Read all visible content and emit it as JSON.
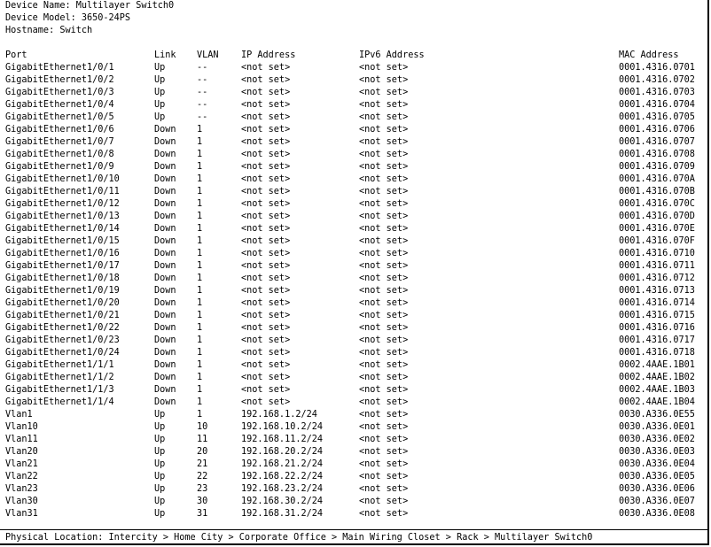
{
  "device": {
    "name_line": "Device Name: Multilayer Switch0",
    "model_line": "Device Model: 3650-24PS",
    "hostname_line": "Hostname: Switch"
  },
  "table": {
    "headers": {
      "port": "Port",
      "link": "Link",
      "vlan": "VLAN",
      "ip": "IP Address",
      "ipv6": "IPv6 Address",
      "mac": "MAC Address"
    },
    "rows": [
      {
        "port": "GigabitEthernet1/0/1",
        "link": "Up",
        "vlan": "--",
        "ip": "<not set>",
        "ipv6": "<not set>",
        "mac": "0001.4316.0701"
      },
      {
        "port": "GigabitEthernet1/0/2",
        "link": "Up",
        "vlan": "--",
        "ip": "<not set>",
        "ipv6": "<not set>",
        "mac": "0001.4316.0702"
      },
      {
        "port": "GigabitEthernet1/0/3",
        "link": "Up",
        "vlan": "--",
        "ip": "<not set>",
        "ipv6": "<not set>",
        "mac": "0001.4316.0703"
      },
      {
        "port": "GigabitEthernet1/0/4",
        "link": "Up",
        "vlan": "--",
        "ip": "<not set>",
        "ipv6": "<not set>",
        "mac": "0001.4316.0704"
      },
      {
        "port": "GigabitEthernet1/0/5",
        "link": "Up",
        "vlan": "--",
        "ip": "<not set>",
        "ipv6": "<not set>",
        "mac": "0001.4316.0705"
      },
      {
        "port": "GigabitEthernet1/0/6",
        "link": "Down",
        "vlan": "1",
        "ip": "<not set>",
        "ipv6": "<not set>",
        "mac": "0001.4316.0706"
      },
      {
        "port": "GigabitEthernet1/0/7",
        "link": "Down",
        "vlan": "1",
        "ip": "<not set>",
        "ipv6": "<not set>",
        "mac": "0001.4316.0707"
      },
      {
        "port": "GigabitEthernet1/0/8",
        "link": "Down",
        "vlan": "1",
        "ip": "<not set>",
        "ipv6": "<not set>",
        "mac": "0001.4316.0708"
      },
      {
        "port": "GigabitEthernet1/0/9",
        "link": "Down",
        "vlan": "1",
        "ip": "<not set>",
        "ipv6": "<not set>",
        "mac": "0001.4316.0709"
      },
      {
        "port": "GigabitEthernet1/0/10",
        "link": "Down",
        "vlan": "1",
        "ip": "<not set>",
        "ipv6": "<not set>",
        "mac": "0001.4316.070A"
      },
      {
        "port": "GigabitEthernet1/0/11",
        "link": "Down",
        "vlan": "1",
        "ip": "<not set>",
        "ipv6": "<not set>",
        "mac": "0001.4316.070B"
      },
      {
        "port": "GigabitEthernet1/0/12",
        "link": "Down",
        "vlan": "1",
        "ip": "<not set>",
        "ipv6": "<not set>",
        "mac": "0001.4316.070C"
      },
      {
        "port": "GigabitEthernet1/0/13",
        "link": "Down",
        "vlan": "1",
        "ip": "<not set>",
        "ipv6": "<not set>",
        "mac": "0001.4316.070D"
      },
      {
        "port": "GigabitEthernet1/0/14",
        "link": "Down",
        "vlan": "1",
        "ip": "<not set>",
        "ipv6": "<not set>",
        "mac": "0001.4316.070E"
      },
      {
        "port": "GigabitEthernet1/0/15",
        "link": "Down",
        "vlan": "1",
        "ip": "<not set>",
        "ipv6": "<not set>",
        "mac": "0001.4316.070F"
      },
      {
        "port": "GigabitEthernet1/0/16",
        "link": "Down",
        "vlan": "1",
        "ip": "<not set>",
        "ipv6": "<not set>",
        "mac": "0001.4316.0710"
      },
      {
        "port": "GigabitEthernet1/0/17",
        "link": "Down",
        "vlan": "1",
        "ip": "<not set>",
        "ipv6": "<not set>",
        "mac": "0001.4316.0711"
      },
      {
        "port": "GigabitEthernet1/0/18",
        "link": "Down",
        "vlan": "1",
        "ip": "<not set>",
        "ipv6": "<not set>",
        "mac": "0001.4316.0712"
      },
      {
        "port": "GigabitEthernet1/0/19",
        "link": "Down",
        "vlan": "1",
        "ip": "<not set>",
        "ipv6": "<not set>",
        "mac": "0001.4316.0713"
      },
      {
        "port": "GigabitEthernet1/0/20",
        "link": "Down",
        "vlan": "1",
        "ip": "<not set>",
        "ipv6": "<not set>",
        "mac": "0001.4316.0714"
      },
      {
        "port": "GigabitEthernet1/0/21",
        "link": "Down",
        "vlan": "1",
        "ip": "<not set>",
        "ipv6": "<not set>",
        "mac": "0001.4316.0715"
      },
      {
        "port": "GigabitEthernet1/0/22",
        "link": "Down",
        "vlan": "1",
        "ip": "<not set>",
        "ipv6": "<not set>",
        "mac": "0001.4316.0716"
      },
      {
        "port": "GigabitEthernet1/0/23",
        "link": "Down",
        "vlan": "1",
        "ip": "<not set>",
        "ipv6": "<not set>",
        "mac": "0001.4316.0717"
      },
      {
        "port": "GigabitEthernet1/0/24",
        "link": "Down",
        "vlan": "1",
        "ip": "<not set>",
        "ipv6": "<not set>",
        "mac": "0001.4316.0718"
      },
      {
        "port": "GigabitEthernet1/1/1",
        "link": "Down",
        "vlan": "1",
        "ip": "<not set>",
        "ipv6": "<not set>",
        "mac": "0002.4AAE.1B01"
      },
      {
        "port": "GigabitEthernet1/1/2",
        "link": "Down",
        "vlan": "1",
        "ip": "<not set>",
        "ipv6": "<not set>",
        "mac": "0002.4AAE.1B02"
      },
      {
        "port": "GigabitEthernet1/1/3",
        "link": "Down",
        "vlan": "1",
        "ip": "<not set>",
        "ipv6": "<not set>",
        "mac": "0002.4AAE.1B03"
      },
      {
        "port": "GigabitEthernet1/1/4",
        "link": "Down",
        "vlan": "1",
        "ip": "<not set>",
        "ipv6": "<not set>",
        "mac": "0002.4AAE.1B04"
      },
      {
        "port": "Vlan1",
        "link": "Up",
        "vlan": "1",
        "ip": "192.168.1.2/24",
        "ipv6": "<not set>",
        "mac": "0030.A336.0E55"
      },
      {
        "port": "Vlan10",
        "link": "Up",
        "vlan": "10",
        "ip": "192.168.10.2/24",
        "ipv6": "<not set>",
        "mac": "0030.A336.0E01"
      },
      {
        "port": "Vlan11",
        "link": "Up",
        "vlan": "11",
        "ip": "192.168.11.2/24",
        "ipv6": "<not set>",
        "mac": "0030.A336.0E02"
      },
      {
        "port": "Vlan20",
        "link": "Up",
        "vlan": "20",
        "ip": "192.168.20.2/24",
        "ipv6": "<not set>",
        "mac": "0030.A336.0E03"
      },
      {
        "port": "Vlan21",
        "link": "Up",
        "vlan": "21",
        "ip": "192.168.21.2/24",
        "ipv6": "<not set>",
        "mac": "0030.A336.0E04"
      },
      {
        "port": "Vlan22",
        "link": "Up",
        "vlan": "22",
        "ip": "192.168.22.2/24",
        "ipv6": "<not set>",
        "mac": "0030.A336.0E05"
      },
      {
        "port": "Vlan23",
        "link": "Up",
        "vlan": "23",
        "ip": "192.168.23.2/24",
        "ipv6": "<not set>",
        "mac": "0030.A336.0E06"
      },
      {
        "port": "Vlan30",
        "link": "Up",
        "vlan": "30",
        "ip": "192.168.30.2/24",
        "ipv6": "<not set>",
        "mac": "0030.A336.0E07"
      },
      {
        "port": "Vlan31",
        "link": "Up",
        "vlan": "31",
        "ip": "192.168.31.2/24",
        "ipv6": "<not set>",
        "mac": "0030.A336.0E08"
      }
    ]
  },
  "footer": {
    "location_line": "Physical Location: Intercity > Home City > Corporate Office > Main Wiring Closet > Rack > Multilayer Switch0"
  }
}
